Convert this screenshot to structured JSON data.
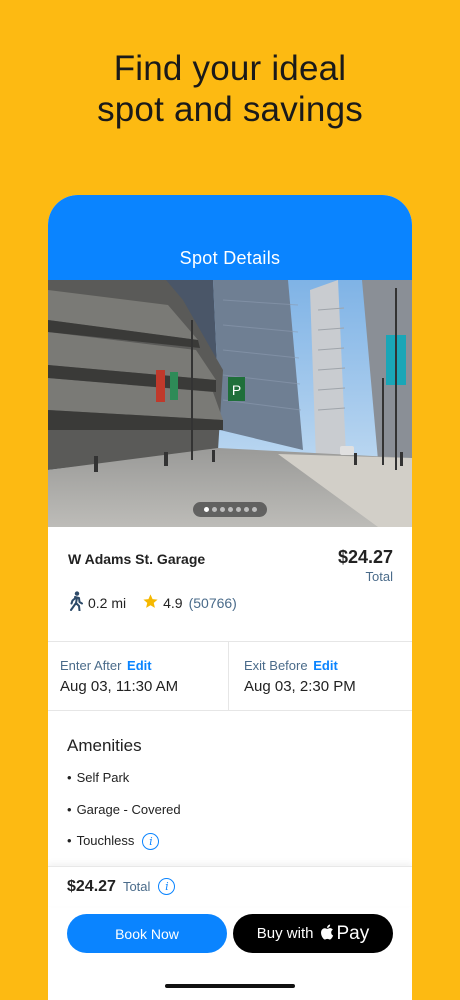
{
  "headline": {
    "line1": "Find your ideal",
    "line2": "spot and savings"
  },
  "nav": {
    "title": "Spot Details"
  },
  "photo": {
    "slide_count": 7,
    "active_slide": 1
  },
  "spot": {
    "name": "W Adams St. Garage",
    "price": "$24.27",
    "price_label": "Total",
    "distance": "0.2 mi",
    "rating": "4.9",
    "review_count": "(50766)"
  },
  "times": {
    "enter_label": "Enter After",
    "exit_label": "Exit Before",
    "edit_label": "Edit",
    "enter_value": "Aug 03, 11:30 AM",
    "exit_value": "Aug 03, 2:30 PM"
  },
  "amenities": {
    "title": "Amenities",
    "items": [
      "Self Park",
      "Garage - Covered",
      "Touchless"
    ]
  },
  "footer": {
    "price": "$24.27",
    "label": "Total"
  },
  "actions": {
    "book": "Book Now",
    "pay_prefix": "Buy with",
    "pay_suffix": "Pay"
  },
  "colors": {
    "background": "#FDBA12",
    "accent": "#0A84FF",
    "rating_star": "#F5B800"
  }
}
